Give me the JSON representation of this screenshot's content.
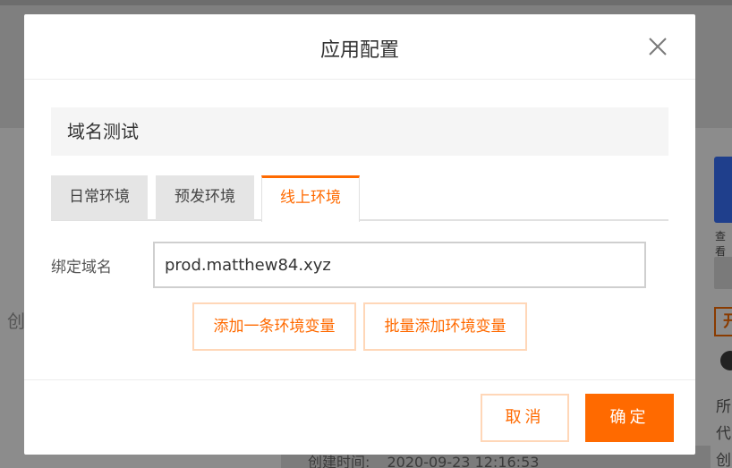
{
  "background": {
    "left_char": "创",
    "view_label": "查看",
    "tag_char": "开",
    "right_lines": [
      "所",
      "代",
      "创"
    ],
    "created_label": "创建时间:",
    "created_value": "2020-09-23 12:16:53"
  },
  "modal": {
    "title": "应用配置",
    "app_name": "域名测试",
    "tabs": [
      {
        "label": "日常环境",
        "active": false
      },
      {
        "label": "预发环境",
        "active": false
      },
      {
        "label": "线上环境",
        "active": true
      }
    ],
    "domain_label": "绑定域名",
    "domain_value": "prod.matthew84.xyz",
    "add_one_label": "添加一条环境变量",
    "add_batch_label": "批量添加环境变量",
    "cancel_label": "取消",
    "ok_label": "确定"
  },
  "colors": {
    "accent": "#ff6a00",
    "accent_border": "#ffd7b8"
  },
  "icons": {
    "close": "close-icon",
    "user": "user-icon"
  }
}
